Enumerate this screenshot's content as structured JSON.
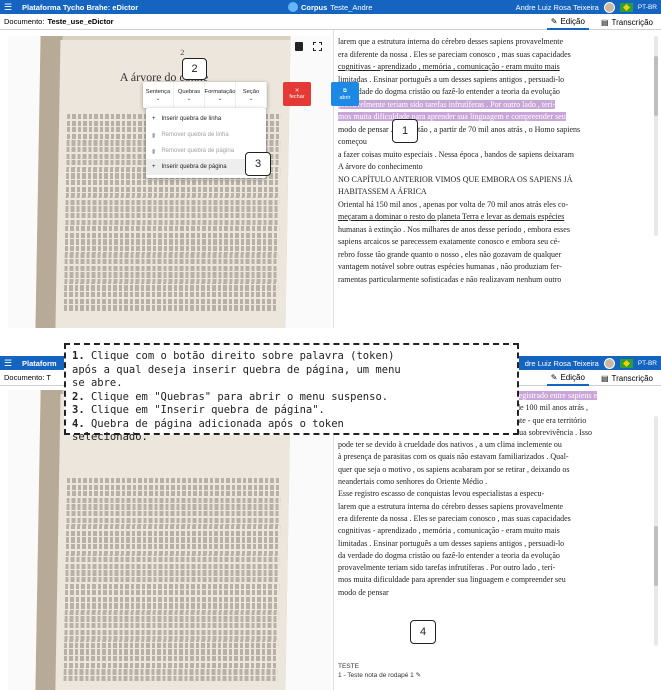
{
  "topbar": {
    "app_title": "Plataforma Tycho Brahe: eDictor",
    "app_title_short": "Plataform",
    "corpus_label": "Corpus",
    "corpus_name": "Teste_Andre",
    "user_name": "Andre Luiz Rosa Teixeira",
    "user_name_short": "dre Luiz Rosa Teixeira",
    "language": "PT-BR"
  },
  "docbar": {
    "label": "Documento:",
    "name": "Teste_use_eDictor",
    "short_label": "Documento: T",
    "tab_edit": "Edição",
    "tab_transcription": "Transcrição"
  },
  "image": {
    "page_number": "2",
    "title": "A árvore do conhe"
  },
  "toolbar": {
    "sentence": "Sentença",
    "breaks": "Quebras",
    "formatting": "Formatação",
    "section": "Seção",
    "close": "fechar",
    "open": "abrir"
  },
  "context_menu": [
    {
      "label": "Inserir quebra de linha",
      "enabled": true
    },
    {
      "label": "Remover quebra de linha",
      "enabled": false
    },
    {
      "label": "Remover quebra de página",
      "enabled": false
    },
    {
      "label": "Inserir quebra de página",
      "enabled": true
    }
  ],
  "callouts": {
    "c1": "1",
    "c2": "2",
    "c3": "3",
    "c4": "4"
  },
  "text_top": [
    "larem que a estrutura interna do cérebro desses sapiens provavelmente",
    "era diferente da nossa . Eles se pareciam conosco , mas suas capacidades",
    "cognitivas - aprendizado , memória , comunicação - eram muito mais",
    "limitadas . Ensinar português a um desses sapiens antigos , persuadi-lo",
    "da verdade do dogma cristão ou fazê-lo entender a teoria da evolução",
    "provavelmente teriam sido tarefas infrutíferas . Por outro lado , terí-",
    "mos muita dificuldade para aprender sua linguagem e compreender seu",
    "modo de pensar . Mas então , a partir de 70 mil anos atrás , o Homo sapiens",
    "começou",
    "a fazer coisas muito especiais . Nessa época , bandos de sapiens deixaram",
    "A árvore do conhecimento",
    "NO CAPÍTULO ANTERIOR VIMOS QUE EMBORA OS SAPIENS JÁ",
    "HABITASSEM A ÁFRICA",
    "Oriental há 150 mil anos , apenas por volta de 70 mil anos atrás eles co-",
    "meçaram a dominar o resto do planeta Terra e levar as demais espécies",
    "humanas à extinção . Nos milhares de anos desse período , embora esses",
    "sapiens arcaicos se parecessem exatamente conosco e embora seu cé-",
    "rebro fosse tão grande quanto o nosso , eles não gozavam de qualquer",
    "vantagem notável sobre outras espécies humanas , não produziam fer-",
    "ramentas particularmente sofisticadas e não realizavam nenhum outro"
  ],
  "text_bottom": [
    "registrado entre sapiens e",
    "de 100 mil anos atrás ,",
    "nte - que era território",
    "sua sobrevivência . Isso",
    "pode ter se devido à crueldade dos nativos , a um clima inclemente ou",
    "à presença de parasitas com os quais não estavam familiarizados . Qual-",
    "quer que seja o motivo , os sapiens acabaram por se retirar , deixando os",
    "neandertais como senhores do Oriente Médio .",
    "Esse registro escasso de conquistas levou especialistas a especu-",
    "larem que a estrutura interna do cérebro desses sapiens provavelmente",
    "era diferente da nossa . Eles se pareciam conosco , mas suas capacidades",
    "cognitivas - aprendizado , memória , comunicação - eram muito mais",
    "limitadas . Ensinar português a um desses sapiens antigos , persuadi-lo",
    "da verdade do dogma cristão ou fazê-lo entender a teoria da evolução",
    "provavelmente teriam sido tarefas infrutíferas . Por outro lado , terí-",
    "mos muita dificuldade para aprender sua linguagem e compreender seu",
    "modo de pensar"
  ],
  "footnote": {
    "label": "TESTE",
    "text": "1 - Teste nota de rodapé 1"
  },
  "instructions": [
    {
      "num": "1.",
      "text": " Clique com o botão direito sobre palavra (token)"
    },
    {
      "num": "",
      "text": "após a qual deseja inserir quebra de página, um menu"
    },
    {
      "num": "",
      "text": "se abre."
    },
    {
      "num": "2.",
      "text": " Clique em \"Quebras\" para abrir o menu suspenso."
    },
    {
      "num": "3.",
      "text": " Clique em \"Inserir quebra de página\"."
    },
    {
      "num": "4.",
      "text": " Quebra de página adicionada após o token"
    },
    {
      "num": "",
      "text": "selecionado."
    }
  ],
  "colors": {
    "brand": "#1565c0",
    "highlight": "#c9a6d9",
    "close": "#e53935",
    "open": "#1e88e5"
  }
}
